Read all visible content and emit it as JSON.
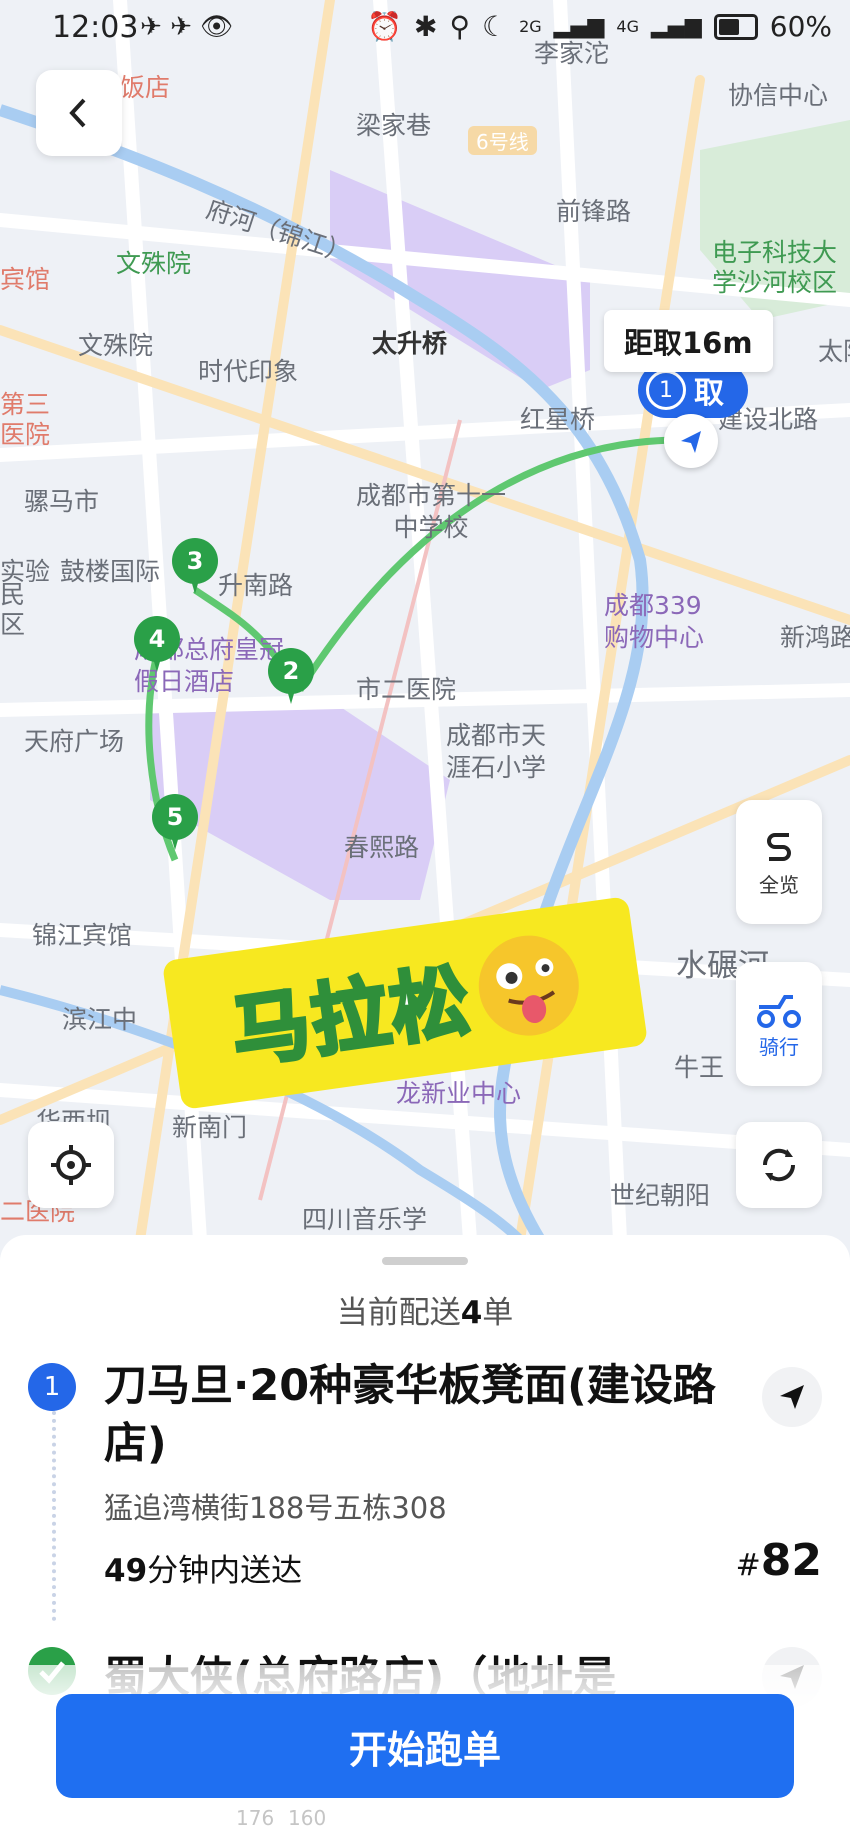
{
  "status_bar": {
    "time": "12:03",
    "icons": [
      "airplane-icon",
      "airplane-icon",
      "eye-icon"
    ],
    "right_icons": [
      "alarm-icon",
      "bluetooth-icon",
      "location-icon",
      "moon-icon",
      "signal-2g-icon",
      "signal-4g-icon",
      "battery-icon"
    ],
    "signal_1": "2G",
    "signal_2": "4G",
    "battery": "60%"
  },
  "map": {
    "labels": {
      "l1": "藏饭店",
      "l2": "梁家巷",
      "l3": "6号线",
      "l4": "协信中心",
      "l5": "前锋路",
      "l6": "府河（锦江）",
      "l7": "文殊院",
      "l8": "宾馆",
      "l9": "电子科技大学沙河校区",
      "l10": "文殊院",
      "l11": "太升桥",
      "l12": "时代印象",
      "l13": "红星桥",
      "l14": "太阳",
      "l15": "第三医院",
      "l16": "骡马市",
      "l17": "成都市第十一中学校",
      "l18": "建设北路",
      "l19": "实验",
      "l20": "鼓楼国际",
      "l21": "升南路",
      "l22": "民区",
      "l23": "成都339购物中心",
      "l24": "新鸿路",
      "l25": "成都总府皇冠假日酒店",
      "l26": "市二医院",
      "l27": "天府广场",
      "l28": "成都市天涯石小学",
      "l29": "春熙路",
      "l30": "锦江宾馆",
      "l31": "水碾河",
      "l32": "滨江中",
      "l33": "牛王",
      "l34": "华西坝",
      "l35": "新南门",
      "l36": "世纪朝阳",
      "l37": "四川音乐学",
      "l38": "二医院",
      "l39": "龙新业中心",
      "l40": "李家沱"
    },
    "distance_label": "距取16m",
    "pickup_marker": {
      "index": "1",
      "label": "取"
    },
    "pins": [
      {
        "label": "3"
      },
      {
        "label": "4"
      },
      {
        "label": "2"
      },
      {
        "label": "5"
      }
    ],
    "sticker_text": "马拉松",
    "buttons": {
      "overview": "全览",
      "ride": "骑行"
    },
    "colors": {
      "route": "#5fc870",
      "pin": "#2aa048",
      "marker": "#2467e8"
    }
  },
  "sheet": {
    "count_prefix": "当前配送",
    "count_value": "4",
    "count_suffix": "单",
    "order1": {
      "index": "1",
      "title": "刀马旦·20种豪华板凳面(建设路店)",
      "address": "猛追湾横街188号五栋308",
      "time_value": "49",
      "time_text": "分钟内送达",
      "number_prefix": "#",
      "number": "82"
    },
    "order2": {
      "title": "蜀大侠(总府路店)（地址是"
    },
    "start_button": "开始跑单",
    "faint_numbers": [
      "176",
      "160"
    ]
  }
}
